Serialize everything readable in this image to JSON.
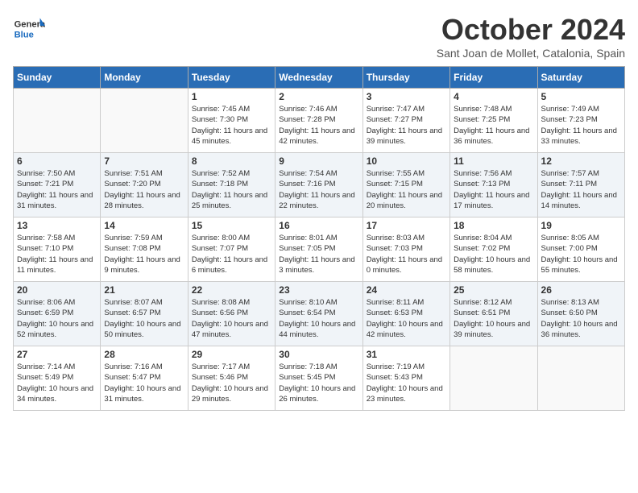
{
  "header": {
    "logo_general": "General",
    "logo_blue": "Blue",
    "month": "October 2024",
    "location": "Sant Joan de Mollet, Catalonia, Spain"
  },
  "weekdays": [
    "Sunday",
    "Monday",
    "Tuesday",
    "Wednesday",
    "Thursday",
    "Friday",
    "Saturday"
  ],
  "weeks": [
    [
      {
        "day": "",
        "info": ""
      },
      {
        "day": "",
        "info": ""
      },
      {
        "day": "1",
        "info": "Sunrise: 7:45 AM\nSunset: 7:30 PM\nDaylight: 11 hours and 45 minutes."
      },
      {
        "day": "2",
        "info": "Sunrise: 7:46 AM\nSunset: 7:28 PM\nDaylight: 11 hours and 42 minutes."
      },
      {
        "day": "3",
        "info": "Sunrise: 7:47 AM\nSunset: 7:27 PM\nDaylight: 11 hours and 39 minutes."
      },
      {
        "day": "4",
        "info": "Sunrise: 7:48 AM\nSunset: 7:25 PM\nDaylight: 11 hours and 36 minutes."
      },
      {
        "day": "5",
        "info": "Sunrise: 7:49 AM\nSunset: 7:23 PM\nDaylight: 11 hours and 33 minutes."
      }
    ],
    [
      {
        "day": "6",
        "info": "Sunrise: 7:50 AM\nSunset: 7:21 PM\nDaylight: 11 hours and 31 minutes."
      },
      {
        "day": "7",
        "info": "Sunrise: 7:51 AM\nSunset: 7:20 PM\nDaylight: 11 hours and 28 minutes."
      },
      {
        "day": "8",
        "info": "Sunrise: 7:52 AM\nSunset: 7:18 PM\nDaylight: 11 hours and 25 minutes."
      },
      {
        "day": "9",
        "info": "Sunrise: 7:54 AM\nSunset: 7:16 PM\nDaylight: 11 hours and 22 minutes."
      },
      {
        "day": "10",
        "info": "Sunrise: 7:55 AM\nSunset: 7:15 PM\nDaylight: 11 hours and 20 minutes."
      },
      {
        "day": "11",
        "info": "Sunrise: 7:56 AM\nSunset: 7:13 PM\nDaylight: 11 hours and 17 minutes."
      },
      {
        "day": "12",
        "info": "Sunrise: 7:57 AM\nSunset: 7:11 PM\nDaylight: 11 hours and 14 minutes."
      }
    ],
    [
      {
        "day": "13",
        "info": "Sunrise: 7:58 AM\nSunset: 7:10 PM\nDaylight: 11 hours and 11 minutes."
      },
      {
        "day": "14",
        "info": "Sunrise: 7:59 AM\nSunset: 7:08 PM\nDaylight: 11 hours and 9 minutes."
      },
      {
        "day": "15",
        "info": "Sunrise: 8:00 AM\nSunset: 7:07 PM\nDaylight: 11 hours and 6 minutes."
      },
      {
        "day": "16",
        "info": "Sunrise: 8:01 AM\nSunset: 7:05 PM\nDaylight: 11 hours and 3 minutes."
      },
      {
        "day": "17",
        "info": "Sunrise: 8:03 AM\nSunset: 7:03 PM\nDaylight: 11 hours and 0 minutes."
      },
      {
        "day": "18",
        "info": "Sunrise: 8:04 AM\nSunset: 7:02 PM\nDaylight: 10 hours and 58 minutes."
      },
      {
        "day": "19",
        "info": "Sunrise: 8:05 AM\nSunset: 7:00 PM\nDaylight: 10 hours and 55 minutes."
      }
    ],
    [
      {
        "day": "20",
        "info": "Sunrise: 8:06 AM\nSunset: 6:59 PM\nDaylight: 10 hours and 52 minutes."
      },
      {
        "day": "21",
        "info": "Sunrise: 8:07 AM\nSunset: 6:57 PM\nDaylight: 10 hours and 50 minutes."
      },
      {
        "day": "22",
        "info": "Sunrise: 8:08 AM\nSunset: 6:56 PM\nDaylight: 10 hours and 47 minutes."
      },
      {
        "day": "23",
        "info": "Sunrise: 8:10 AM\nSunset: 6:54 PM\nDaylight: 10 hours and 44 minutes."
      },
      {
        "day": "24",
        "info": "Sunrise: 8:11 AM\nSunset: 6:53 PM\nDaylight: 10 hours and 42 minutes."
      },
      {
        "day": "25",
        "info": "Sunrise: 8:12 AM\nSunset: 6:51 PM\nDaylight: 10 hours and 39 minutes."
      },
      {
        "day": "26",
        "info": "Sunrise: 8:13 AM\nSunset: 6:50 PM\nDaylight: 10 hours and 36 minutes."
      }
    ],
    [
      {
        "day": "27",
        "info": "Sunrise: 7:14 AM\nSunset: 5:49 PM\nDaylight: 10 hours and 34 minutes."
      },
      {
        "day": "28",
        "info": "Sunrise: 7:16 AM\nSunset: 5:47 PM\nDaylight: 10 hours and 31 minutes."
      },
      {
        "day": "29",
        "info": "Sunrise: 7:17 AM\nSunset: 5:46 PM\nDaylight: 10 hours and 29 minutes."
      },
      {
        "day": "30",
        "info": "Sunrise: 7:18 AM\nSunset: 5:45 PM\nDaylight: 10 hours and 26 minutes."
      },
      {
        "day": "31",
        "info": "Sunrise: 7:19 AM\nSunset: 5:43 PM\nDaylight: 10 hours and 23 minutes."
      },
      {
        "day": "",
        "info": ""
      },
      {
        "day": "",
        "info": ""
      }
    ]
  ]
}
